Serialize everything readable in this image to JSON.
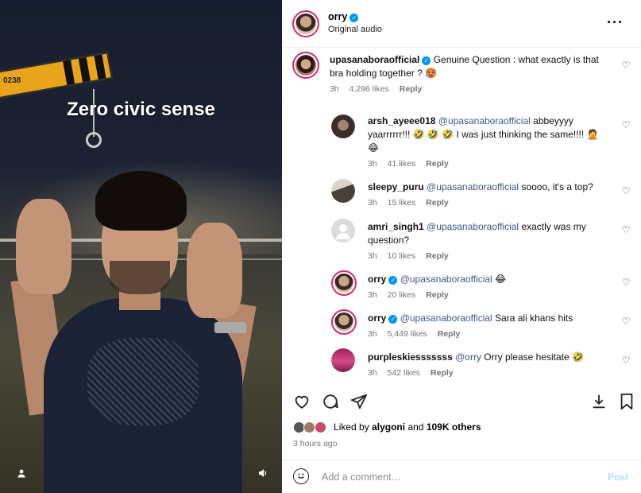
{
  "video": {
    "overlay_title": "Zero civic sense",
    "crane_label": "0238"
  },
  "post": {
    "author": "orry",
    "audio": "Original audio"
  },
  "comments": [
    {
      "user": "upasanaboraofficial",
      "verified": true,
      "mention": "",
      "text": "Genuine Question : what exactly is that bra holding together ? 🥵",
      "age": "3h",
      "likes": "4,296 likes",
      "reply": "Reply"
    },
    {
      "user": "arsh_ayeee018",
      "verified": false,
      "mention": "@upasanaboraofficial",
      "text": "abbeyyyy yaarrrrrr!!! 🤣 🤣 🤣 I was just thinking the same!!!! 🤦 😂",
      "age": "3h",
      "likes": "41 likes",
      "reply": "Reply"
    },
    {
      "user": "sleepy_puru",
      "verified": false,
      "mention": "@upasanaboraofficial",
      "text": "soooo, it's a top?",
      "age": "3h",
      "likes": "15 likes",
      "reply": "Reply"
    },
    {
      "user": "amri_singh1",
      "verified": false,
      "mention": "@upasanaboraofficial",
      "text": "exactly was my question?",
      "age": "3h",
      "likes": "10 likes",
      "reply": "Reply"
    },
    {
      "user": "orry",
      "verified": true,
      "mention": "@upasanaboraofficial",
      "text": "😂",
      "age": "3h",
      "likes": "20 likes",
      "reply": "Reply"
    },
    {
      "user": "orry",
      "verified": true,
      "mention": "@upasanaboraofficial",
      "text": "Sara ali khans hits",
      "age": "3h",
      "likes": "5,449 likes",
      "reply": "Reply"
    },
    {
      "user": "purpleskiesssssss",
      "verified": false,
      "mention": "@orry",
      "text": "Orry please hesitate 🤣",
      "age": "3h",
      "likes": "542 likes",
      "reply": "Reply"
    }
  ],
  "likes": {
    "prefix": "Liked by",
    "user": "alygoni",
    "and": "and",
    "others": "109K others"
  },
  "posted_time": "3 hours ago",
  "add_comment": {
    "placeholder": "Add a comment…",
    "post_label": "Post"
  },
  "icons": {
    "more": "more-options-icon",
    "heart": "heart-icon",
    "comment": "comment-icon",
    "share": "share-icon",
    "download": "download-icon",
    "save": "bookmark-icon",
    "emoji": "emoji-icon",
    "user": "person-icon",
    "volume": "volume-icon"
  },
  "colors": {
    "accent": "#0095f6",
    "mention": "#3d5a8a",
    "muted": "#737373",
    "story_ring": "#d62976"
  }
}
